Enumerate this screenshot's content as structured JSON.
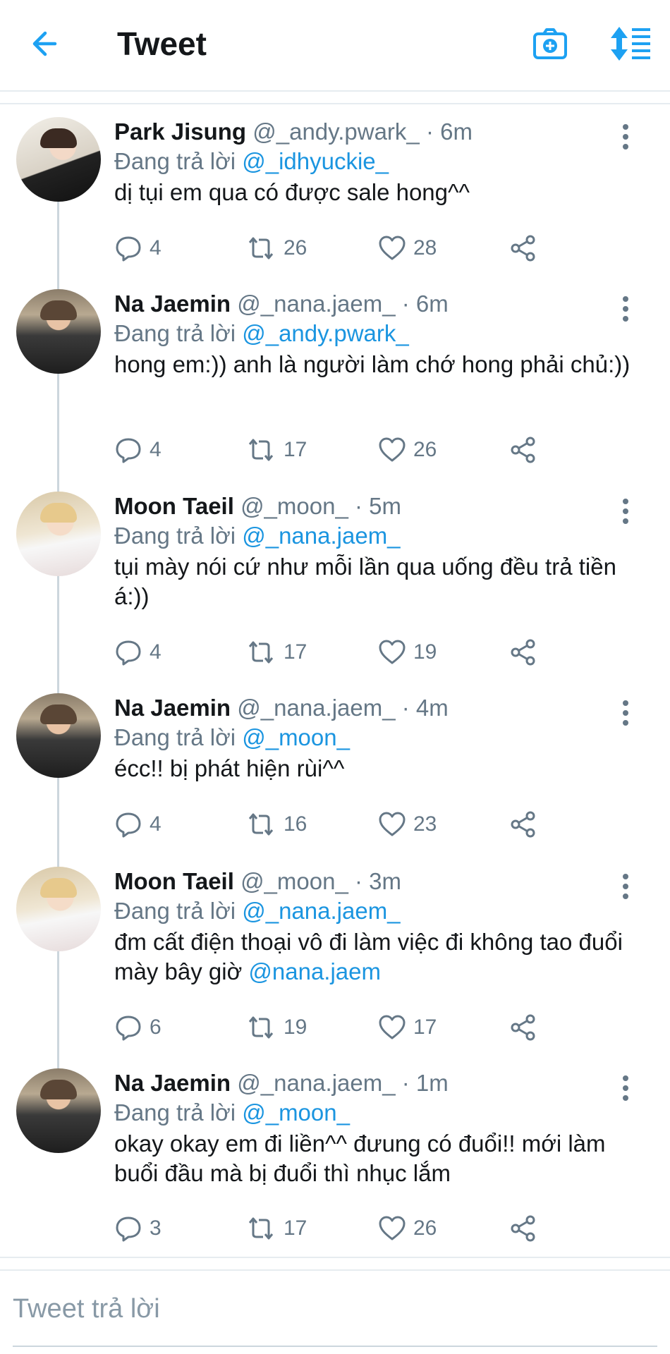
{
  "header": {
    "title": "Tweet",
    "accent_color": "#1da1f2",
    "icons": [
      "back-arrow-icon",
      "camera-plus-icon",
      "sort-toggle-icon"
    ]
  },
  "tweets": [
    {
      "name": "Park Jisung",
      "handle": "@_andy.pwark_",
      "time": "· 6m",
      "replying_label": "Đang trả lời",
      "replying_to": "@_idhyuckie_",
      "text": "dị tụi em qua có được sale hong^^",
      "replies": "4",
      "retweets": "26",
      "likes": "28"
    },
    {
      "name": "Na Jaemin",
      "handle": "@_nana.jaem_",
      "time": "· 6m",
      "replying_label": "Đang trả lời",
      "replying_to": "@_andy.pwark_",
      "text": "hong em:)) anh là người làm chớ hong phải chủ:))",
      "replies": "4",
      "retweets": "17",
      "likes": "26"
    },
    {
      "name": "Moon Taeil",
      "handle": "@_moon_",
      "time": "· 5m",
      "replying_label": "Đang trả lời",
      "replying_to": "@_nana.jaem_",
      "text": "tụi mày nói cứ như mỗi lần qua uống đều trả tiền á:))",
      "replies": "4",
      "retweets": "17",
      "likes": "19"
    },
    {
      "name": "Na Jaemin",
      "handle": "@_nana.jaem_",
      "time": "· 4m",
      "replying_label": "Đang trả lời",
      "replying_to": "@_moon_",
      "text": "écc!! bị phát hiện rùi^^",
      "replies": "4",
      "retweets": "16",
      "likes": "23"
    },
    {
      "name": "Moon Taeil",
      "handle": "@_moon_",
      "time": "· 3m",
      "replying_label": "Đang trả lời",
      "replying_to": "@_nana.jaem_",
      "text": "đm cất điện thoại vô đi làm việc đi không tao đuổi mày bây giờ",
      "text_mention": "@nana.jaem",
      "replies": "6",
      "retweets": "19",
      "likes": "17"
    },
    {
      "name": "Na Jaemin",
      "handle": "@_nana.jaem_",
      "time": "· 1m",
      "replying_label": "Đang trả lời",
      "replying_to": "@_moon_",
      "text": "okay okay em đi liền^^ đưung có đuổi!! mới làm buổi đầu mà bị đuổi thì nhục lắm",
      "replies": "3",
      "retweets": "17",
      "likes": "26"
    }
  ],
  "compose": {
    "placeholder": "Tweet trả lời"
  }
}
